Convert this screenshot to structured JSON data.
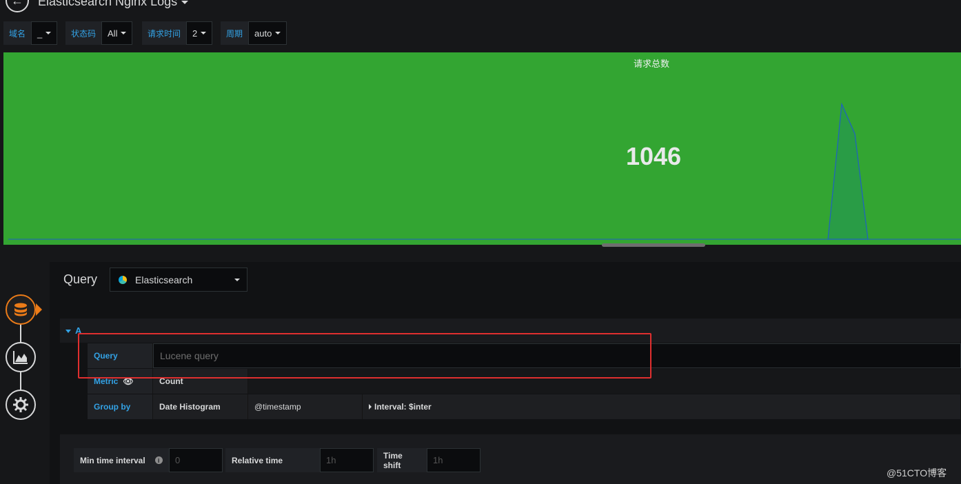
{
  "header": {
    "back_label": "←",
    "title": "Elasticsearch Nginx Logs"
  },
  "variables": [
    {
      "label": "域名",
      "value": "_"
    },
    {
      "label": "状态码",
      "value": "All"
    },
    {
      "label": "请求时间",
      "value": "2"
    },
    {
      "label": "周期",
      "value": "auto"
    }
  ],
  "panel": {
    "title": "请求总数",
    "value": "1046",
    "background": "#33a532",
    "sparkline_color": "#1f60c4",
    "sparkline_fill": "#299c46"
  },
  "editor": {
    "query_label": "Query",
    "datasource": "Elasticsearch",
    "row": {
      "letter": "A",
      "query_label": "Query",
      "query_placeholder": "Lucene query",
      "metric_label": "Metric",
      "metric_value": "Count",
      "group_label": "Group by",
      "group_type": "Date Histogram",
      "group_field": "@timestamp",
      "group_interval": "Interval: $inter"
    },
    "options": {
      "min_interval_label": "Min time interval",
      "min_interval_placeholder": "0",
      "relative_time_label": "Relative time",
      "relative_time_placeholder": "1h",
      "time_shift_label": "Time shift",
      "time_shift_placeholder": "1h"
    }
  },
  "watermark": "@51CTO博客"
}
